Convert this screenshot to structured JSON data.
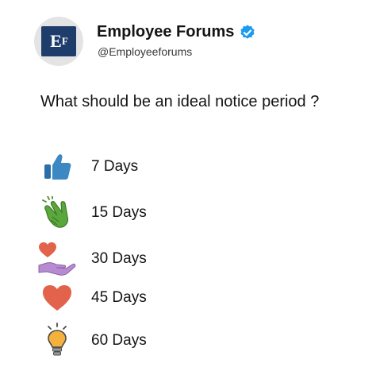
{
  "account": {
    "name": "Employee Forums",
    "handle": "@Employeeforums",
    "verified": true,
    "logo_text": "E",
    "logo_superscript": "F",
    "brand_color": "#1f3d6b",
    "verified_color": "#1d9bf0"
  },
  "post": {
    "question": "What should be an ideal notice period ?"
  },
  "options": [
    {
      "label": "7 Days",
      "icon": "thumbs-up-icon",
      "color": "#3b88c3"
    },
    {
      "label": "15 Days",
      "icon": "clapping-hands-icon",
      "color": "#5aa83b"
    },
    {
      "label": "30 Days",
      "icon": "hand-with-heart-icon",
      "color": "#e2624b"
    },
    {
      "label": "45 Days",
      "icon": "heart-icon",
      "color": "#e2624b"
    },
    {
      "label": "60 Days",
      "icon": "lightbulb-icon",
      "color": "#f5b13d"
    }
  ]
}
